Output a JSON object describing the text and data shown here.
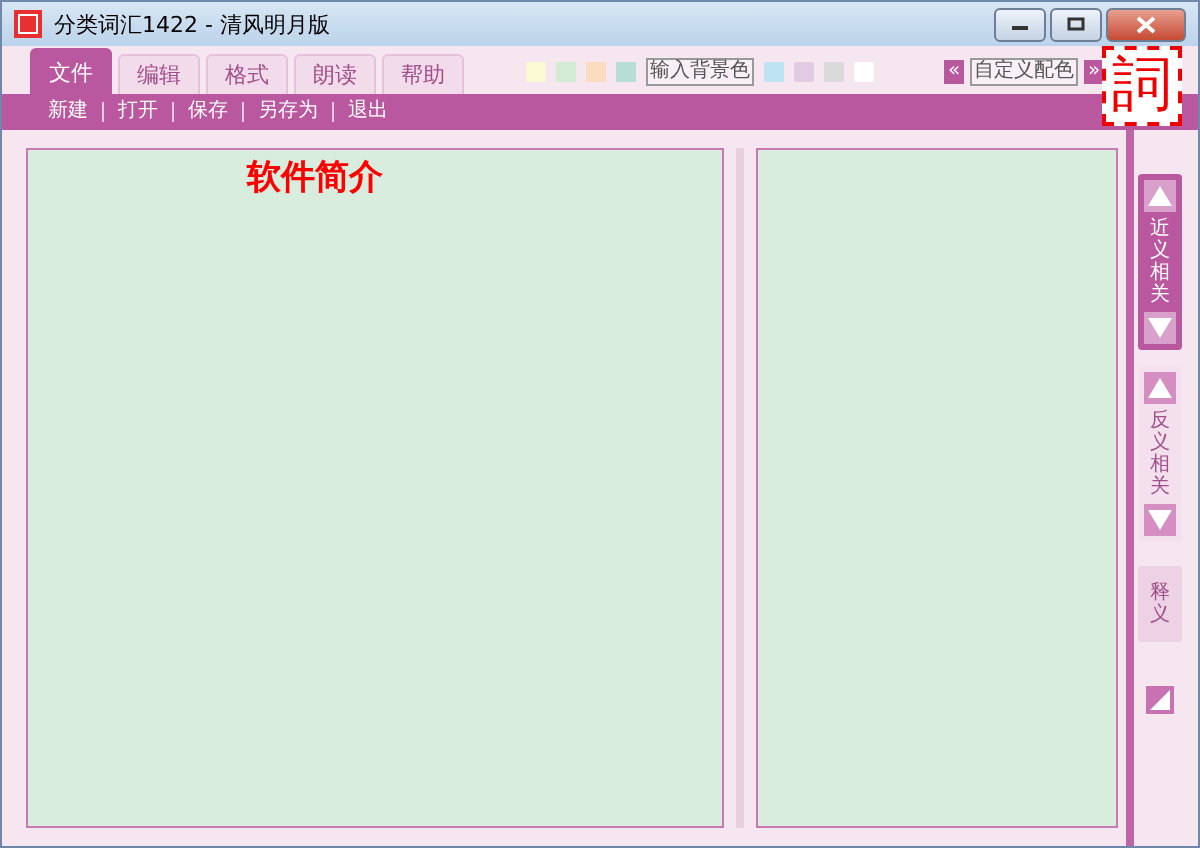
{
  "window": {
    "title": "分类词汇1422 - 清风明月版"
  },
  "tabs": [
    {
      "label": "文件",
      "selected": true
    },
    {
      "label": "编辑",
      "selected": false
    },
    {
      "label": "格式",
      "selected": false
    },
    {
      "label": "朗读",
      "selected": false
    },
    {
      "label": "帮助",
      "selected": false
    }
  ],
  "swatches_left": [
    {
      "color": "#fbf8d4"
    },
    {
      "color": "#d3ead3"
    },
    {
      "color": "#f9dcc2"
    },
    {
      "color": "#b6ddd6"
    }
  ],
  "bg_input_button": "输入背景色",
  "swatches_right": [
    {
      "color": "#bde4f3"
    },
    {
      "color": "#e3cbe3"
    },
    {
      "color": "#dadada"
    },
    {
      "color": "#ffffff"
    }
  ],
  "custom_color": {
    "prev": "«",
    "label": "自定义配色",
    "next": "»"
  },
  "logo_text": "詞",
  "menu": [
    "新建",
    "打开",
    "保存",
    "另存为",
    "退出"
  ],
  "left_panel": {
    "heading": "软件简介"
  },
  "side_tabs": [
    {
      "label": "近义相关",
      "selected": true,
      "arrows": true
    },
    {
      "label": "反义相关",
      "selected": false,
      "arrows": true
    },
    {
      "label": "释义",
      "selected": false,
      "arrows": false
    }
  ]
}
